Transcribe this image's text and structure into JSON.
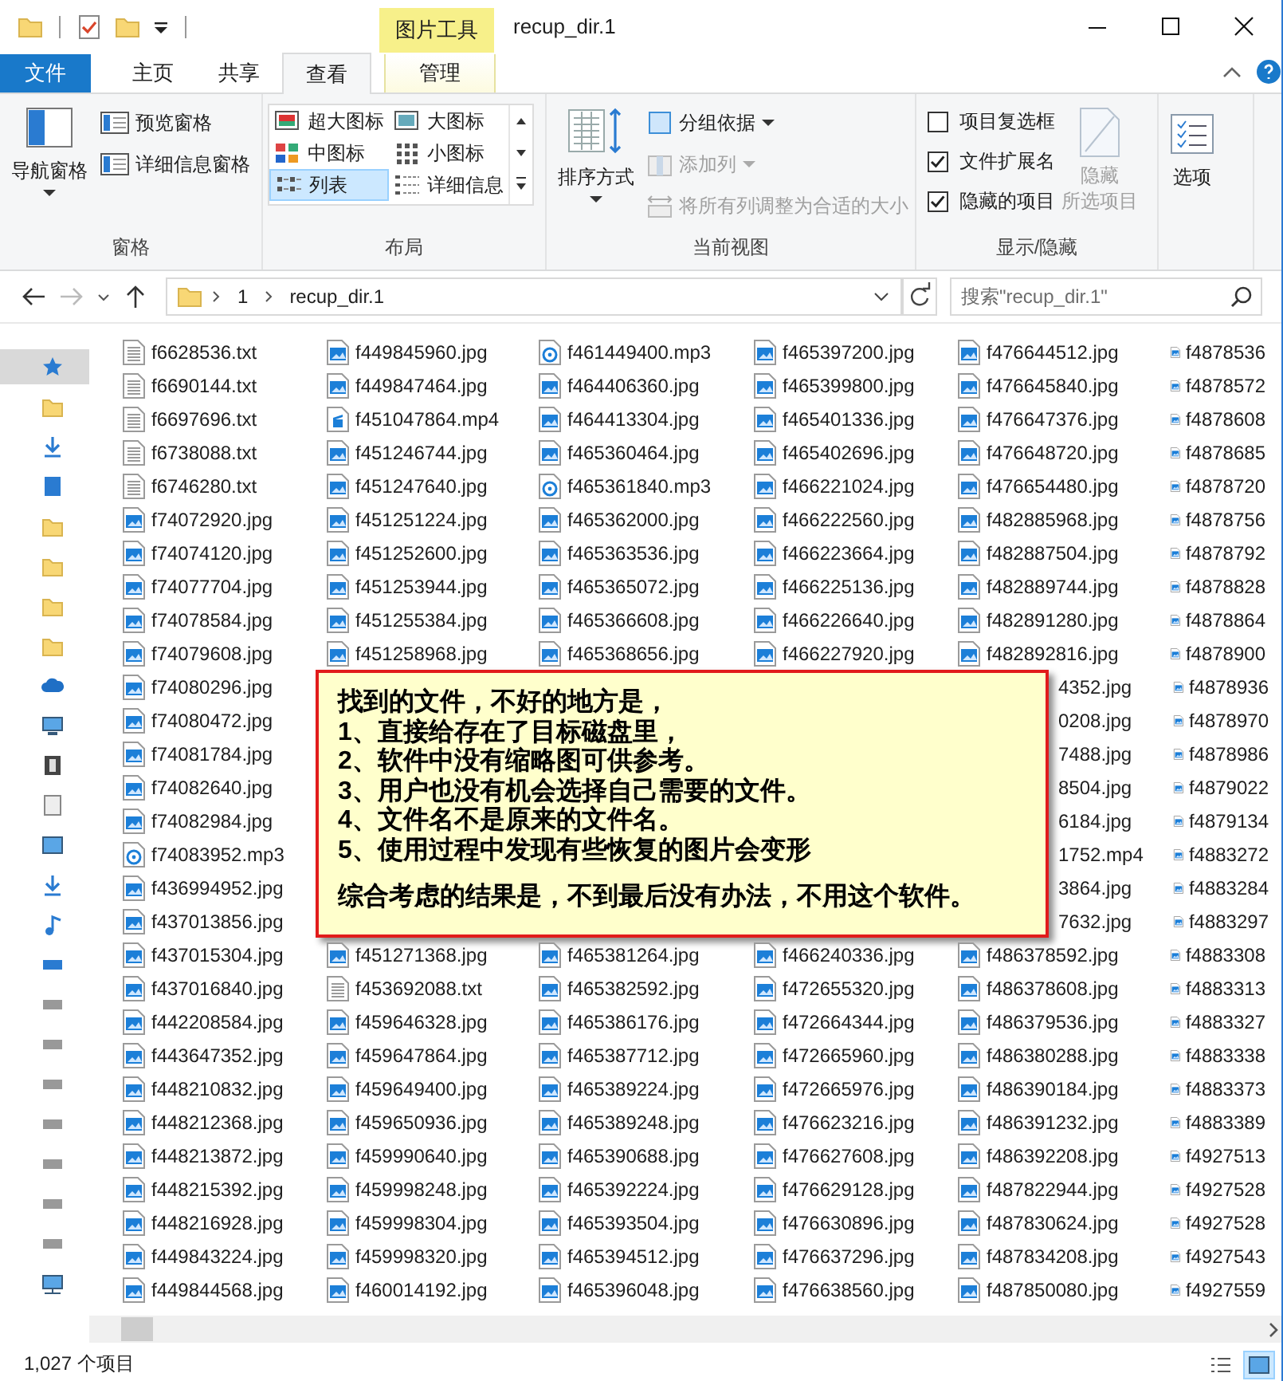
{
  "window": {
    "title": "recup_dir.1",
    "context_label": "图片工具"
  },
  "ribbon": {
    "tabs": [
      {
        "label": "文件",
        "kind": "file",
        "selected": false
      },
      {
        "label": "主页",
        "kind": "normal",
        "selected": false
      },
      {
        "label": "共享",
        "kind": "normal",
        "selected": false
      },
      {
        "label": "查看",
        "kind": "normal",
        "selected": true
      },
      {
        "label": "管理",
        "kind": "context",
        "selected": false
      }
    ],
    "panes": {
      "title": "窗格",
      "navigation": "导航窗格",
      "preview": "预览窗格",
      "details": "详细信息窗格"
    },
    "layout": {
      "title": "布局",
      "options": [
        {
          "label": "超大图标",
          "selected": false
        },
        {
          "label": "大图标",
          "selected": false
        },
        {
          "label": "中图标",
          "selected": false
        },
        {
          "label": "小图标",
          "selected": false
        },
        {
          "label": "列表",
          "selected": true
        },
        {
          "label": "详细信息",
          "selected": false
        }
      ]
    },
    "current_view": {
      "title": "当前视图",
      "sort": "排序方式",
      "group_by": {
        "label": "分组依据",
        "disabled": false
      },
      "add_column": {
        "label": "添加列",
        "disabled": true
      },
      "fit_columns": {
        "label": "将所有列调整为合适的大小",
        "disabled": true
      }
    },
    "show_hide": {
      "title": "显示/隐藏",
      "checkboxes": [
        {
          "label": "项目复选框",
          "checked": false
        },
        {
          "label": "文件扩展名",
          "checked": true
        },
        {
          "label": "隐藏的项目",
          "checked": true
        }
      ],
      "hide_selected": {
        "lines": [
          "隐藏",
          "所选项目"
        ],
        "disabled": true
      }
    },
    "options": {
      "label": "选项"
    }
  },
  "address_bar": {
    "forward_disabled": true,
    "path": [
      "1",
      "recup_dir.1"
    ],
    "search_placeholder": "搜索\"recup_dir.1\""
  },
  "file_list": {
    "upper": [
      [
        {
          "name": "f6628536.txt",
          "kind": "txt"
        },
        {
          "name": "f6690144.txt",
          "kind": "txt"
        },
        {
          "name": "f6697696.txt",
          "kind": "txt"
        },
        {
          "name": "f6738088.txt",
          "kind": "txt"
        },
        {
          "name": "f6746280.txt",
          "kind": "txt"
        },
        {
          "name": "f74072920.jpg",
          "kind": "jpg"
        },
        {
          "name": "f74074120.jpg",
          "kind": "jpg"
        },
        {
          "name": "f74077704.jpg",
          "kind": "jpg"
        },
        {
          "name": "f74078584.jpg",
          "kind": "jpg"
        },
        {
          "name": "f74079608.jpg",
          "kind": "jpg"
        }
      ],
      [
        {
          "name": "f449845960.jpg",
          "kind": "jpg"
        },
        {
          "name": "f449847464.jpg",
          "kind": "jpg"
        },
        {
          "name": "f451047864.mp4",
          "kind": "mp4"
        },
        {
          "name": "f451246744.jpg",
          "kind": "jpg"
        },
        {
          "name": "f451247640.jpg",
          "kind": "jpg"
        },
        {
          "name": "f451251224.jpg",
          "kind": "jpg"
        },
        {
          "name": "f451252600.jpg",
          "kind": "jpg"
        },
        {
          "name": "f451253944.jpg",
          "kind": "jpg"
        },
        {
          "name": "f451255384.jpg",
          "kind": "jpg"
        },
        {
          "name": "f451258968.jpg",
          "kind": "jpg"
        }
      ],
      [
        {
          "name": "f461449400.mp3",
          "kind": "mp3"
        },
        {
          "name": "f464406360.jpg",
          "kind": "jpg"
        },
        {
          "name": "f464413304.jpg",
          "kind": "jpg"
        },
        {
          "name": "f465360464.jpg",
          "kind": "jpg"
        },
        {
          "name": "f465361840.mp3",
          "kind": "mp3"
        },
        {
          "name": "f465362000.jpg",
          "kind": "jpg"
        },
        {
          "name": "f465363536.jpg",
          "kind": "jpg"
        },
        {
          "name": "f465365072.jpg",
          "kind": "jpg"
        },
        {
          "name": "f465366608.jpg",
          "kind": "jpg"
        },
        {
          "name": "f465368656.jpg",
          "kind": "jpg"
        }
      ],
      [
        {
          "name": "f465397200.jpg",
          "kind": "jpg"
        },
        {
          "name": "f465399800.jpg",
          "kind": "jpg"
        },
        {
          "name": "f465401336.jpg",
          "kind": "jpg"
        },
        {
          "name": "f465402696.jpg",
          "kind": "jpg"
        },
        {
          "name": "f466221024.jpg",
          "kind": "jpg"
        },
        {
          "name": "f466222560.jpg",
          "kind": "jpg"
        },
        {
          "name": "f466223664.jpg",
          "kind": "jpg"
        },
        {
          "name": "f466225136.jpg",
          "kind": "jpg"
        },
        {
          "name": "f466226640.jpg",
          "kind": "jpg"
        },
        {
          "name": "f466227920.jpg",
          "kind": "jpg"
        }
      ],
      [
        {
          "name": "f476644512.jpg",
          "kind": "jpg"
        },
        {
          "name": "f476645840.jpg",
          "kind": "jpg"
        },
        {
          "name": "f476647376.jpg",
          "kind": "jpg"
        },
        {
          "name": "f476648720.jpg",
          "kind": "jpg"
        },
        {
          "name": "f476654480.jpg",
          "kind": "jpg"
        },
        {
          "name": "f482885968.jpg",
          "kind": "jpg"
        },
        {
          "name": "f482887504.jpg",
          "kind": "jpg"
        },
        {
          "name": "f482889744.jpg",
          "kind": "jpg"
        },
        {
          "name": "f482891280.jpg",
          "kind": "jpg"
        },
        {
          "name": "f482892816.jpg",
          "kind": "jpg"
        }
      ],
      [
        {
          "name": "f4878536",
          "kind": "jpg"
        },
        {
          "name": "f4878572",
          "kind": "jpg"
        },
        {
          "name": "f4878608",
          "kind": "jpg"
        },
        {
          "name": "f4878685",
          "kind": "jpg"
        },
        {
          "name": "f4878720",
          "kind": "jpg"
        },
        {
          "name": "f4878756",
          "kind": "jpg"
        },
        {
          "name": "f4878792",
          "kind": "jpg"
        },
        {
          "name": "f4878828",
          "kind": "jpg"
        },
        {
          "name": "f4878864",
          "kind": "jpg"
        },
        {
          "name": "f4878900",
          "kind": "jpg"
        }
      ]
    ],
    "middle": {
      "first_column": [
        {
          "name": "f74080296.jpg",
          "kind": "jpg"
        },
        {
          "name": "f74080472.jpg",
          "kind": "jpg"
        },
        {
          "name": "f74081784.jpg",
          "kind": "jpg"
        },
        {
          "name": "f74082640.jpg",
          "kind": "jpg"
        },
        {
          "name": "f74082984.jpg",
          "kind": "jpg"
        },
        {
          "name": "f74083952.mp3",
          "kind": "mp3"
        },
        {
          "name": "f436994952.jpg",
          "kind": "jpg"
        },
        {
          "name": "f437013856.jpg",
          "kind": "jpg"
        }
      ],
      "note": {
        "lines": [
          "找到的文件，不好的地方是，",
          "1、直接给存在了目标磁盘里，",
          "2、软件中没有缩略图可供参考。",
          "3、用户也没有机会选择自己需要的文件。",
          "4、文件名不是原来的文件名。",
          "5、使用过程中发现有些恢复的图片会变形"
        ],
        "conclusion": "综合考虑的结果是，不到最后没有办法，不用这个软件。"
      },
      "fifth_column_visible_parts": [
        "4352.jpg",
        "0208.jpg",
        "7488.jpg",
        "8504.jpg",
        "6184.jpg",
        "1752.mp4",
        "3864.jpg",
        "7632.jpg"
      ],
      "last_column": [
        {
          "name": "f4878936",
          "kind": "jpg"
        },
        {
          "name": "f4878970",
          "kind": "jpg"
        },
        {
          "name": "f4878986",
          "kind": "jpg"
        },
        {
          "name": "f4879022",
          "kind": "jpg"
        },
        {
          "name": "f4879134",
          "kind": "jpg"
        },
        {
          "name": "f4883272",
          "kind": "jpg"
        },
        {
          "name": "f4883284",
          "kind": "jpg"
        },
        {
          "name": "f4883297",
          "kind": "jpg"
        }
      ]
    },
    "lower": [
      [
        {
          "name": "f437015304.jpg",
          "kind": "jpg"
        },
        {
          "name": "f437016840.jpg",
          "kind": "jpg"
        },
        {
          "name": "f442208584.jpg",
          "kind": "jpg"
        },
        {
          "name": "f443647352.jpg",
          "kind": "jpg"
        },
        {
          "name": "f448210832.jpg",
          "kind": "jpg"
        },
        {
          "name": "f448212368.jpg",
          "kind": "jpg"
        },
        {
          "name": "f448213872.jpg",
          "kind": "jpg"
        },
        {
          "name": "f448215392.jpg",
          "kind": "jpg"
        },
        {
          "name": "f448216928.jpg",
          "kind": "jpg"
        },
        {
          "name": "f449843224.jpg",
          "kind": "jpg"
        },
        {
          "name": "f449844568.jpg",
          "kind": "jpg"
        }
      ],
      [
        {
          "name": "f451271368.jpg",
          "kind": "jpg"
        },
        {
          "name": "f453692088.txt",
          "kind": "txt"
        },
        {
          "name": "f459646328.jpg",
          "kind": "jpg"
        },
        {
          "name": "f459647864.jpg",
          "kind": "jpg"
        },
        {
          "name": "f459649400.jpg",
          "kind": "jpg"
        },
        {
          "name": "f459650936.jpg",
          "kind": "jpg"
        },
        {
          "name": "f459990640.jpg",
          "kind": "jpg"
        },
        {
          "name": "f459998248.jpg",
          "kind": "jpg"
        },
        {
          "name": "f459998304.jpg",
          "kind": "jpg"
        },
        {
          "name": "f459998320.jpg",
          "kind": "jpg"
        },
        {
          "name": "f460014192.jpg",
          "kind": "jpg"
        }
      ],
      [
        {
          "name": "f465381264.jpg",
          "kind": "jpg"
        },
        {
          "name": "f465382592.jpg",
          "kind": "jpg"
        },
        {
          "name": "f465386176.jpg",
          "kind": "jpg"
        },
        {
          "name": "f465387712.jpg",
          "kind": "jpg"
        },
        {
          "name": "f465389224.jpg",
          "kind": "jpg"
        },
        {
          "name": "f465389248.jpg",
          "kind": "jpg"
        },
        {
          "name": "f465390688.jpg",
          "kind": "jpg"
        },
        {
          "name": "f465392224.jpg",
          "kind": "jpg"
        },
        {
          "name": "f465393504.jpg",
          "kind": "jpg"
        },
        {
          "name": "f465394512.jpg",
          "kind": "jpg"
        },
        {
          "name": "f465396048.jpg",
          "kind": "jpg"
        }
      ],
      [
        {
          "name": "f466240336.jpg",
          "kind": "jpg"
        },
        {
          "name": "f472655320.jpg",
          "kind": "jpg"
        },
        {
          "name": "f472664344.jpg",
          "kind": "jpg"
        },
        {
          "name": "f472665960.jpg",
          "kind": "jpg"
        },
        {
          "name": "f472665976.jpg",
          "kind": "jpg"
        },
        {
          "name": "f476623216.jpg",
          "kind": "jpg"
        },
        {
          "name": "f476627608.jpg",
          "kind": "jpg"
        },
        {
          "name": "f476629128.jpg",
          "kind": "jpg"
        },
        {
          "name": "f476630896.jpg",
          "kind": "jpg"
        },
        {
          "name": "f476637296.jpg",
          "kind": "jpg"
        },
        {
          "name": "f476638560.jpg",
          "kind": "jpg"
        }
      ],
      [
        {
          "name": "f486378592.jpg",
          "kind": "jpg"
        },
        {
          "name": "f486378608.jpg",
          "kind": "jpg"
        },
        {
          "name": "f486379536.jpg",
          "kind": "jpg"
        },
        {
          "name": "f486380288.jpg",
          "kind": "jpg"
        },
        {
          "name": "f486390184.jpg",
          "kind": "jpg"
        },
        {
          "name": "f486391232.jpg",
          "kind": "jpg"
        },
        {
          "name": "f486392208.jpg",
          "kind": "jpg"
        },
        {
          "name": "f487822944.jpg",
          "kind": "jpg"
        },
        {
          "name": "f487830624.jpg",
          "kind": "jpg"
        },
        {
          "name": "f487834208.jpg",
          "kind": "jpg"
        },
        {
          "name": "f487850080.jpg",
          "kind": "jpg"
        }
      ],
      [
        {
          "name": "f4883308",
          "kind": "jpg"
        },
        {
          "name": "f4883313",
          "kind": "jpg"
        },
        {
          "name": "f4883327",
          "kind": "jpg"
        },
        {
          "name": "f4883338",
          "kind": "jpg"
        },
        {
          "name": "f4883373",
          "kind": "jpg"
        },
        {
          "name": "f4883389",
          "kind": "jpg"
        },
        {
          "name": "f4927513",
          "kind": "jpg"
        },
        {
          "name": "f4927528",
          "kind": "jpg"
        },
        {
          "name": "f4927528",
          "kind": "jpg"
        },
        {
          "name": "f4927543",
          "kind": "jpg"
        },
        {
          "name": "f4927559",
          "kind": "jpg"
        }
      ]
    ]
  },
  "status_bar": {
    "item_count": "1,027 个项目",
    "views": [
      {
        "kind": "details",
        "selected": false
      },
      {
        "kind": "large_icons",
        "selected": true
      }
    ]
  }
}
